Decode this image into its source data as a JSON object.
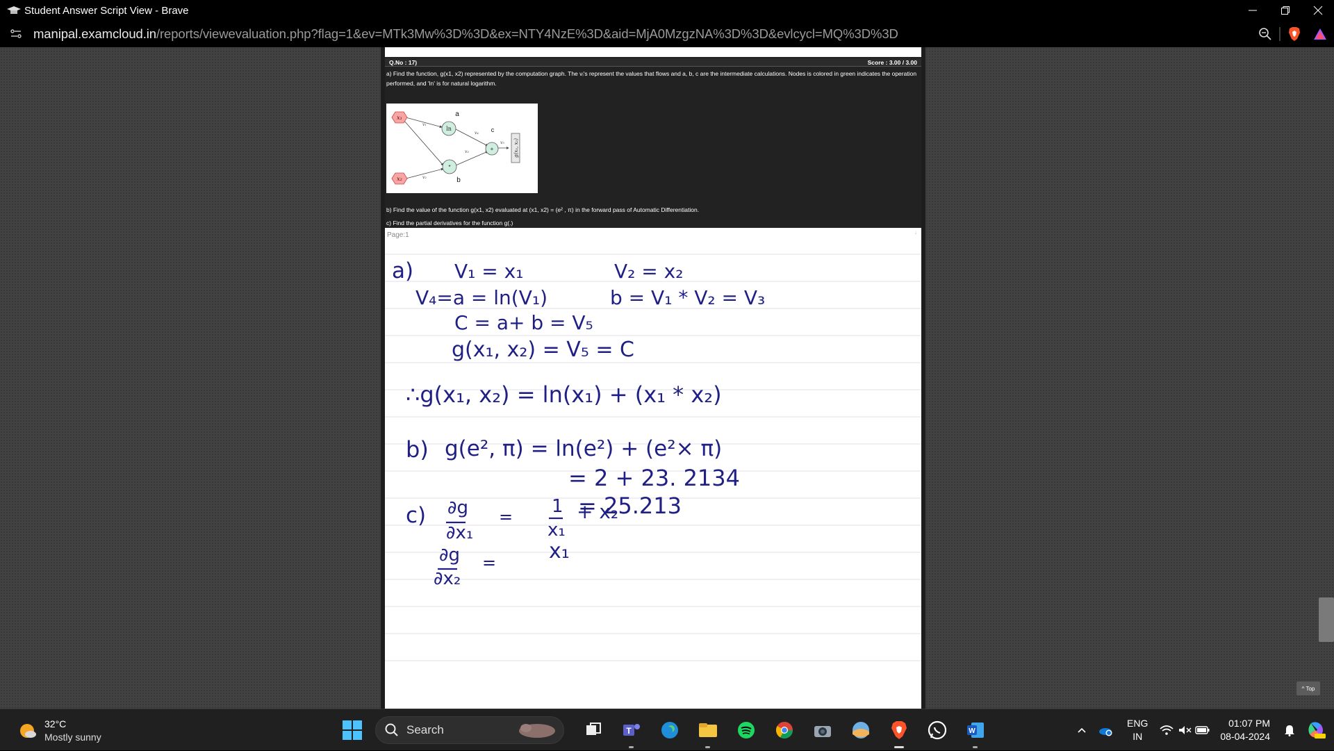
{
  "window": {
    "title": "Student Answer Script View - Brave"
  },
  "address": {
    "host": "manipal.examcloud.in",
    "path": "/reports/viewevaluation.php?flag=1&ev=MTk3Mw%3D%3D&ex=NTY4NzE%3D&aid=MjA0MzgzNA%3D%3D&evlcycl=MQ%3D%3D"
  },
  "question": {
    "number": "Q.No : 17)",
    "score": "Score : 3.00 / 3.00",
    "part_a": "a) Find the function, g(x1, x2) represented by the computation graph. The vᵢ's represent the values that flows and a, b, c are the intermediate calculations. Nodes is colored in green indicates the operation performed, and 'ln' is for natural logarithm.",
    "part_b": "b) Find the value of the function g(x1, x2) evaluated at (x1, x2) = (e² , π) in the forward pass of Automatic Differentiation.",
    "part_c": "c) Find the partial derivatives for the function g(.)",
    "graph": {
      "x1": "x₁",
      "x2": "x₂",
      "ln": "ln",
      "plus": "+",
      "times": "*",
      "a": "a",
      "b": "b",
      "c": "c",
      "v1": "v₁",
      "v2": "v₂",
      "v3": "v₃",
      "v4": "v₄",
      "v5": "v₅",
      "output": "g(x₁, x₂)"
    }
  },
  "answer": {
    "page_label": "Page:1",
    "corner_mark": "↓",
    "lines": {
      "l1a": "a)",
      "l1b": "V₁ = x₁",
      "l1c": "V₂ = x₂",
      "l2a": "V₄=a = ln(V₁)",
      "l2b": "b = V₁ * V₂ = V₃",
      "l3": "C = a+ b = V₅",
      "l4": "g(x₁, x₂) = V₅ = C",
      "l5": "∴g(x₁, x₂) = ln(x₁) + (x₁ * x₂)",
      "l6a": "b)",
      "l6b": "g(e², π) = ln(e²) + (e²× π)",
      "l7": "= 2 + 23. 2134",
      "l8": "= 25.213",
      "c_label": "c)",
      "d1_num": "∂g",
      "d1_den": "∂x₁",
      "d1_eq": "=",
      "d1_rhs_num": "1",
      "d1_rhs_den": "x₁",
      "d1_plus": "+ x₂",
      "d2_num": "∂g",
      "d2_den": "∂x₂",
      "d2_eq": "=",
      "d2_rhs": "x₁"
    }
  },
  "top_button": "^ Top",
  "taskbar": {
    "temp": "32°C",
    "condition": "Mostly sunny",
    "search_label": "Search",
    "lang1": "ENG",
    "lang2": "IN",
    "time": "01:07 PM",
    "date": "08-04-2024"
  }
}
